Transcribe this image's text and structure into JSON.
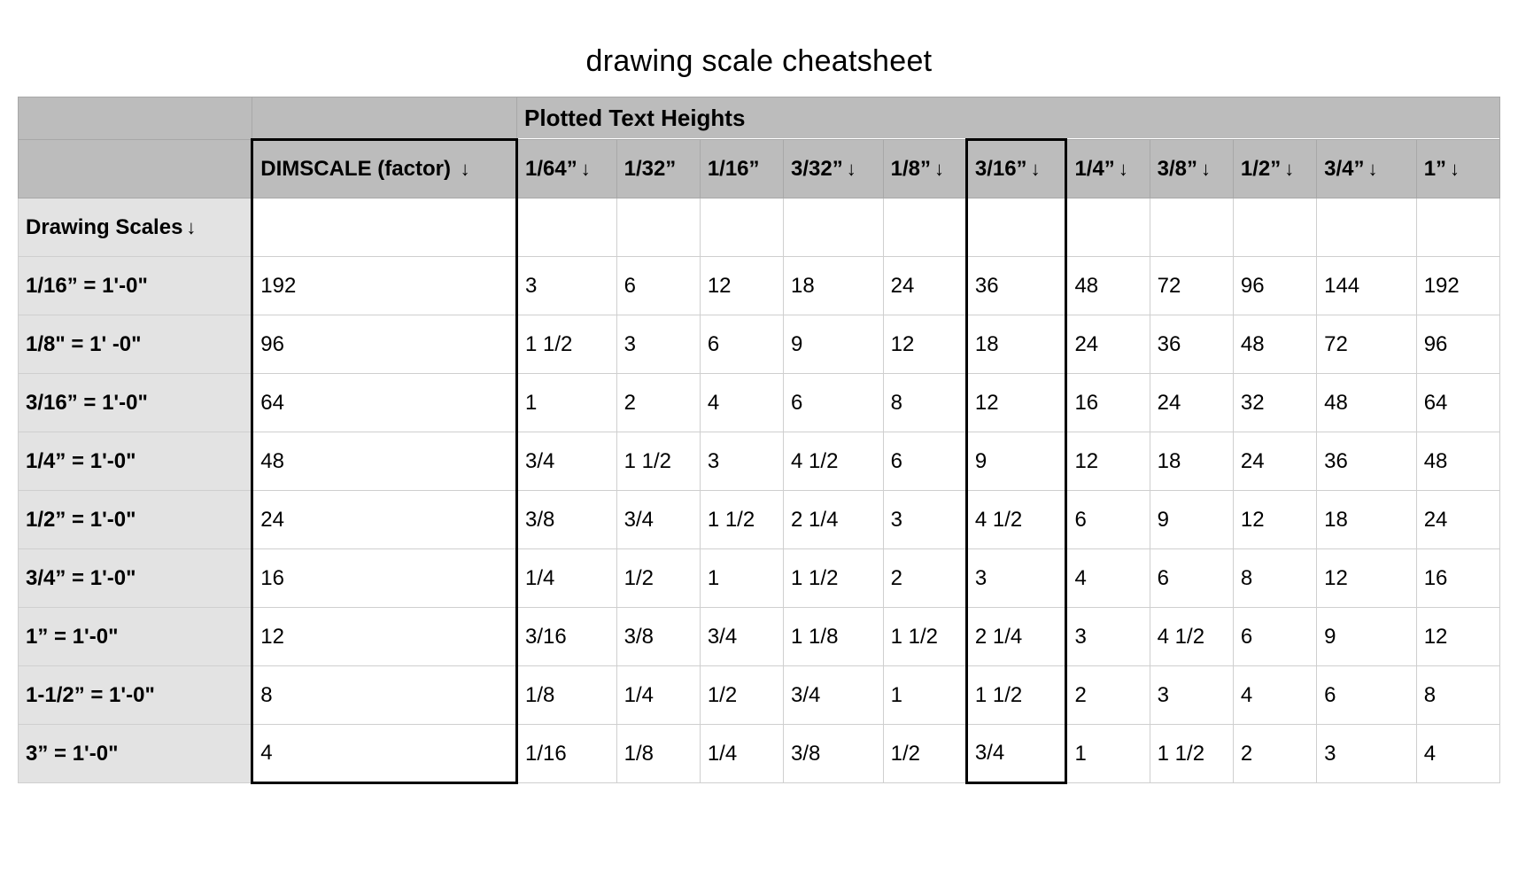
{
  "title": "drawing scale cheatsheet",
  "header_section_label": "Plotted Text Heights",
  "dimscale_label": "DIMSCALE (factor)",
  "row_section_label": "Drawing Scales",
  "arrow_glyph": "↓",
  "textHeightHeaders": [
    "1/64”",
    "1/32”",
    "1/16”",
    "3/32”",
    "1/8”",
    "3/16”",
    "1/4”",
    "3/8”",
    "1/2”",
    "3/4”",
    "1”"
  ],
  "header_sort_arrows": [
    true,
    false,
    false,
    true,
    true,
    true,
    true,
    true,
    true,
    true,
    true
  ],
  "highlight_dimscale": true,
  "highlight_col_index": 5,
  "rows": [
    {
      "scale": "1/16” = 1'-0\"",
      "dimscale": "192",
      "values": [
        "3",
        "6",
        "12",
        "18",
        "24",
        "36",
        "48",
        "72",
        "96",
        "144",
        "192"
      ]
    },
    {
      "scale": "1/8\" = 1' -0\"",
      "dimscale": "96",
      "values": [
        "1 1/2",
        "3",
        "6",
        "9",
        "12",
        "18",
        "24",
        "36",
        "48",
        "72",
        "96"
      ]
    },
    {
      "scale": "3/16” = 1'-0\"",
      "dimscale": "64",
      "values": [
        "1",
        "2",
        "4",
        "6",
        "8",
        "12",
        "16",
        "24",
        "32",
        "48",
        "64"
      ]
    },
    {
      "scale": "1/4” = 1'-0\"",
      "dimscale": "48",
      "values": [
        "3/4",
        "1 1/2",
        "3",
        "4 1/2",
        "6",
        "9",
        "12",
        "18",
        "24",
        "36",
        "48"
      ]
    },
    {
      "scale": "1/2” = 1'-0\"",
      "dimscale": "24",
      "values": [
        "3/8",
        "3/4",
        "1 1/2",
        "2 1/4",
        "3",
        "4 1/2",
        "6",
        "9",
        "12",
        "18",
        "24"
      ]
    },
    {
      "scale": "3/4” = 1'-0\"",
      "dimscale": "16",
      "values": [
        "1/4",
        "1/2",
        "1",
        "1 1/2",
        "2",
        "3",
        "4",
        "6",
        "8",
        "12",
        "16"
      ]
    },
    {
      "scale": "1” = 1'-0\"",
      "dimscale": "12",
      "values": [
        "3/16",
        "3/8",
        "3/4",
        "1 1/8",
        "1 1/2",
        "2 1/4",
        "3",
        "4 1/2",
        "6",
        "9",
        "12"
      ]
    },
    {
      "scale": "1-1/2” = 1'-0\"",
      "dimscale": "8",
      "values": [
        "1/8",
        "1/4",
        "1/2",
        "3/4",
        "1",
        "1 1/2",
        "2",
        "3",
        "4",
        "6",
        "8"
      ]
    },
    {
      "scale": "3” = 1'-0\"",
      "dimscale": "4",
      "values": [
        "1/16",
        "1/8",
        "1/4",
        "3/8",
        "1/2",
        "3/4",
        "1",
        "1 1/2",
        "2",
        "3",
        "4"
      ]
    }
  ]
}
